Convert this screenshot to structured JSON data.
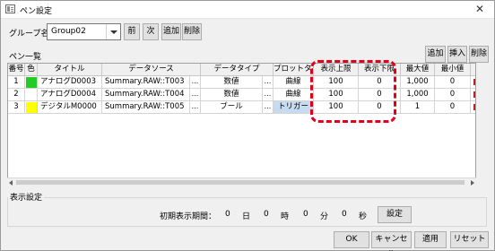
{
  "window": {
    "title": "ペン設定",
    "close_glyph": "✕"
  },
  "group": {
    "label": "グループ名",
    "value": "Group02",
    "prev_label": "前",
    "next_label": "次",
    "add_label": "追加",
    "delete_label": "削除"
  },
  "pen_list": {
    "title": "ペン一覧",
    "add_label": "追加",
    "insert_label": "挿入",
    "delete_label": "削除",
    "columns": [
      "番号",
      "色",
      "タイトル",
      "データソース",
      "データタイプ",
      "プロットタイプ",
      "表示上限",
      "表示下限",
      "最大値",
      "最小値"
    ],
    "rows": [
      {
        "no": "1",
        "color": "#22cc22",
        "title": "アナログD0003",
        "source": "Summary.RAW::T003",
        "ellipsis": "...",
        "dtype": "数値",
        "plot": "曲線",
        "upper": "100",
        "lower": "0",
        "max": "1,000",
        "min": "0"
      },
      {
        "no": "2",
        "color": "#ffffff",
        "title": "アナログD0004",
        "source": "Summary.RAW::T004",
        "ellipsis": "...",
        "dtype": "数値",
        "plot": "曲線",
        "upper": "100",
        "lower": "0",
        "max": "1,000",
        "min": "0"
      },
      {
        "no": "3",
        "color": "#ffff00",
        "title": "デジタルM0000",
        "source": "Summary.RAW::T005",
        "ellipsis": "...",
        "dtype": "ブール",
        "plot": "トリガー",
        "upper": "100",
        "lower": "0",
        "max": "1",
        "min": "0"
      }
    ]
  },
  "display": {
    "group_label": "表示設定",
    "period_label": "初期表示期間：",
    "days": "0",
    "days_unit": "日",
    "hours": "0",
    "hours_unit": "時",
    "minutes": "0",
    "minutes_unit": "分",
    "seconds": "0",
    "seconds_unit": "秒",
    "settings_label": "設定"
  },
  "footer": {
    "ok_label": "OK",
    "cancel_label": "キャンセル",
    "apply_label": "適用",
    "reset_label": "リセット"
  },
  "colors": {
    "highlight": "#e0001a",
    "plot_selected": "#c6daf0"
  }
}
